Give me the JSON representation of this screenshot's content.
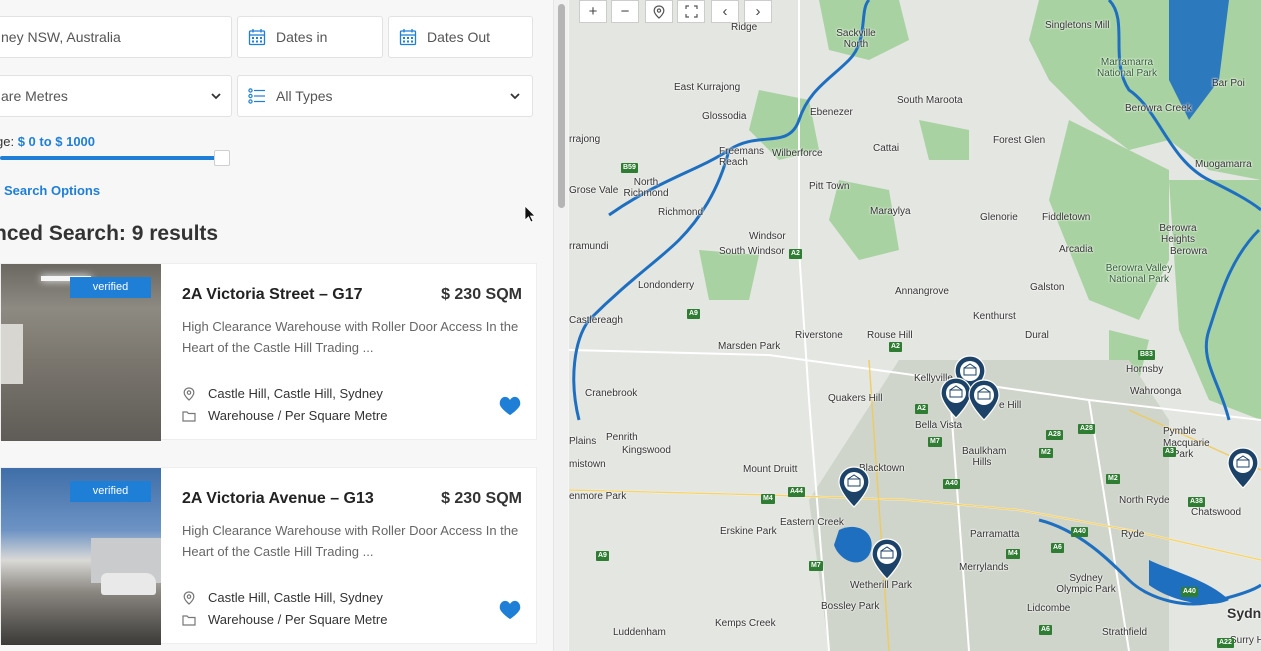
{
  "search": {
    "location_value": "ney NSW, Australia",
    "dates_in_placeholder": "Dates in",
    "dates_out_placeholder": "Dates Out",
    "size_value": "are Metres",
    "type_value": "All Types",
    "range_prefix": "ge: ",
    "range_value": "$ 0 to $ 1000",
    "range_fraction": 1.0,
    "options_link": "Search Options"
  },
  "results": {
    "title": "nced Search: 9 results",
    "items": [
      {
        "badge": "verified",
        "title": "2A Victoria Street – G17",
        "price": "$ 230 SQM",
        "description": "High Clearance Warehouse with Roller Door Access In the Heart of the Castle Hill Trading ...",
        "location": "Castle Hill, Castle Hill, Sydney",
        "category": "Warehouse / Per Square Metre"
      },
      {
        "badge": "verified",
        "title": "2A Victoria Avenue – G13",
        "price": "$ 230 SQM",
        "description": "High Clearance Warehouse with Roller Door Access In the Heart of the Castle Hill Trading ...",
        "location": "Castle Hill, Castle Hill, Sydney",
        "category": "Warehouse / Per Square Metre"
      }
    ]
  },
  "map": {
    "controls": [
      "+",
      "−",
      "pin-icon",
      "fullscreen-icon",
      "‹",
      "›"
    ],
    "labels": {
      "ridge": "Ridge",
      "sackville": "Sackville North",
      "singletons_mill": "Singletons Mill",
      "marramarra": "Marramarra National Park",
      "east_kurrajong": "East Kurrajong",
      "south_maroota": "South Maroota",
      "glossodia": "Glossodia",
      "ebenezer": "Ebenezer",
      "berowra_creek": "Berowra Creek",
      "bar_point": "Bar Poi",
      "arrajong": "rrajong",
      "freemans_reach": "Freemans Reach",
      "wilberforce": "Wilberforce",
      "cattai": "Cattai",
      "forest_glen": "Forest Glen",
      "muogamarra": "Muogamarra",
      "grose_vale": "Grose Vale",
      "north_richmond": "North Richmond",
      "pitt_town": "Pitt Town",
      "maraylya": "Maraylya",
      "glenorie": "Glenorie",
      "fiddletown": "Fiddletown",
      "richmond": "Richmond",
      "windsor": "Windsor",
      "south_windsor": "South Windsor",
      "arcadia": "Arcadia",
      "berowra_heights": "Berowra Heights",
      "berowra": "Berowra",
      "armundi": "rramundi",
      "londonderry": "Londonderry",
      "annangrove": "Annangrove",
      "galston": "Galston",
      "berowra_valley": "Berowra Valley National Park",
      "castlereagh": "Castlereagh",
      "kenthurst": "Kenthurst",
      "riverstone": "Riverstone",
      "rouse_hill": "Rouse Hill",
      "dural": "Dural",
      "marsden_park": "Marsden Park",
      "hornsby": "Hornsby",
      "kellyville": "Kellyville",
      "cranebrook": "Cranebrook",
      "quakers_hill": "Quakers Hill",
      "castle_hill_fragment": "e Hill",
      "wahroonga": "Wahroonga",
      "bella_vista": "Bella Vista",
      "penrith": "Penrith",
      "plains": "Plains",
      "kingswood": "Kingswood",
      "pymble": "Pymble",
      "baulkham_hills": "Baulkham Hills",
      "mount_druitt": "Mount Druitt",
      "blacktown": "Blacktown",
      "macquarie_park": "Macquarie Park",
      "emistown": "mistown",
      "enmore_park": "enmore Park",
      "north_ryde": "North Ryde",
      "eastern_creek": "Eastern Creek",
      "chatswood": "Chatswood",
      "erskine_park": "Erskine Park",
      "parramatta": "Parramatta",
      "ryde": "Ryde",
      "wetherill_park": "Wetherill Park",
      "merrylands": "Merrylands",
      "sydney_olympic_park": "Sydney Olympic Park",
      "bossley_park": "Bossley Park",
      "lidcombe": "Lidcombe",
      "kemps_creek": "Kemps Creek",
      "luddenham": "Luddenham",
      "strathfield": "Strathfield",
      "sydney": "Sydn",
      "surry_hills": "Surry H"
    },
    "shields": [
      "B59",
      "A2",
      "A9",
      "A2",
      "A28",
      "B83",
      "A2",
      "M7",
      "A28",
      "M2",
      "A3",
      "A44",
      "M4",
      "A40",
      "M2",
      "A38",
      "A40",
      "A6",
      "M4",
      "M7",
      "A9",
      "A40",
      "A6",
      "A22"
    ]
  },
  "colors": {
    "accent": "#1f7fd6",
    "pin": "#1c4268",
    "water": "#1f6fc0",
    "park": "#a8d1a0"
  }
}
